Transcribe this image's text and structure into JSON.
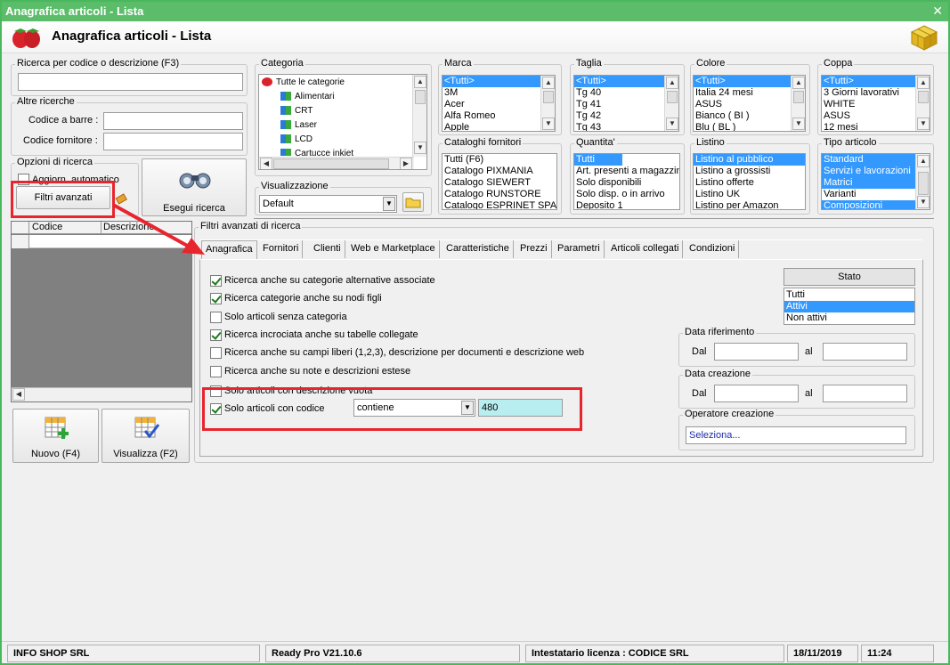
{
  "window": {
    "title": "Anagrafica articoli  - Lista",
    "header_title": "Anagrafica articoli  - Lista"
  },
  "search": {
    "label": "Ricerca per codice o descrizione (F3)",
    "value": ""
  },
  "other_search": {
    "label": "Altre ricerche",
    "barcode_label": "Codice a barre :",
    "supplier_code_label": "Codice fornitore :"
  },
  "search_options": {
    "label": "Opzioni di ricerca",
    "auto_update_label": "Aggiorn. automatico",
    "advanced_filters_label": "Filtri avanzati",
    "execute_label": "Esegui ricerca"
  },
  "categoria": {
    "label": "Categoria",
    "items": [
      "Tutte le categorie",
      "Alimentari",
      "CRT",
      "Laser",
      "LCD",
      "Cartucce inkjet"
    ]
  },
  "visualizzazione": {
    "label": "Visualizzazione",
    "value": "Default"
  },
  "marca": {
    "label": "Marca",
    "items": [
      "<Tutti>",
      "3M",
      "Acer",
      "Alfa Romeo",
      "Apple"
    ]
  },
  "taglia": {
    "label": "Taglia",
    "items": [
      "<Tutti>",
      "Tg 40",
      "Tg 41",
      "Tg 42",
      "Tg 43"
    ]
  },
  "colore": {
    "label": "Colore",
    "items": [
      "<Tutti>",
      "Italia 24 mesi",
      "ASUS",
      "Bianco ( BI )",
      "Blu ( BL )"
    ]
  },
  "coppa": {
    "label": "Coppa",
    "items": [
      "<Tutti>",
      "3 Giorni lavorativi",
      "WHITE",
      "ASUS",
      "12 mesi"
    ]
  },
  "cataloghi": {
    "label": "Cataloghi fornitori",
    "items": [
      "Tutti (F6)",
      "Catalogo PIXMANIA",
      "Catalogo SIEWERT",
      "Catalogo RUNSTORE",
      "Catalogo ESPRINET SPA"
    ]
  },
  "quantita": {
    "label": "Quantita'",
    "items": [
      "Tutti",
      "Art. presenti a magazzino",
      "Solo disponibili",
      "Solo disp. o in arrivo",
      "Deposito 1"
    ]
  },
  "listino": {
    "label": "Listino",
    "items": [
      "Listino al pubblico",
      "Listino a grossisti",
      "Listino offerte",
      "Listino UK",
      "Listino per Amazon"
    ]
  },
  "tipo_articolo": {
    "label": "Tipo articolo",
    "items": [
      "Standard",
      "Servizi e lavorazioni",
      "Matrici",
      "Varianti",
      "Composizioni"
    ]
  },
  "grid": {
    "col_codice": "Codice",
    "col_descrizione": "Descrizione"
  },
  "buttons": {
    "nuovo": "Nuovo (F4)",
    "visualizza": "Visualizza (F2)"
  },
  "advanced": {
    "label": "Filtri avanzati di ricerca",
    "tabs": [
      "Anagrafica",
      "Fornitori",
      "Clienti",
      "Web e Marketplace",
      "Caratteristiche",
      "Prezzi",
      "Parametri",
      "Articoli collegati",
      "Condizioni"
    ],
    "checks": [
      "Ricerca anche su categorie alternative associate",
      "Ricerca categorie anche su nodi figli",
      "Solo articoli senza categoria",
      "Ricerca incrociata anche su tabelle collegate",
      "Ricerca anche su campi liberi (1,2,3), descrizione per documenti e descrizione web",
      "Ricerca anche su note e descrizioni estese",
      "Solo articoli con descrizione vuota",
      "Solo articoli con codice"
    ],
    "operator_value": "contiene",
    "code_value": "480",
    "stato": {
      "header": "Stato",
      "items": [
        "Tutti",
        "Attivi",
        "Non attivi"
      ]
    },
    "data_riferimento": {
      "label": "Data riferimento",
      "dal": "Dal",
      "al": "al"
    },
    "data_creazione": {
      "label": "Data creazione",
      "dal": "Dal",
      "al": "al"
    },
    "operatore": {
      "label": "Operatore creazione",
      "value": "Seleziona..."
    }
  },
  "statusbar": {
    "company": "INFO SHOP SRL",
    "version": "Ready Pro V21.10.6",
    "license": "Intestatario licenza : CODICE SRL",
    "date": "18/11/2019",
    "time": "11:24"
  },
  "colors": {
    "title_green": "#5bbd6a",
    "selection_blue": "#3399ff",
    "highlight_red": "#e8242d",
    "code_input_cyan": "#b9eef0"
  }
}
